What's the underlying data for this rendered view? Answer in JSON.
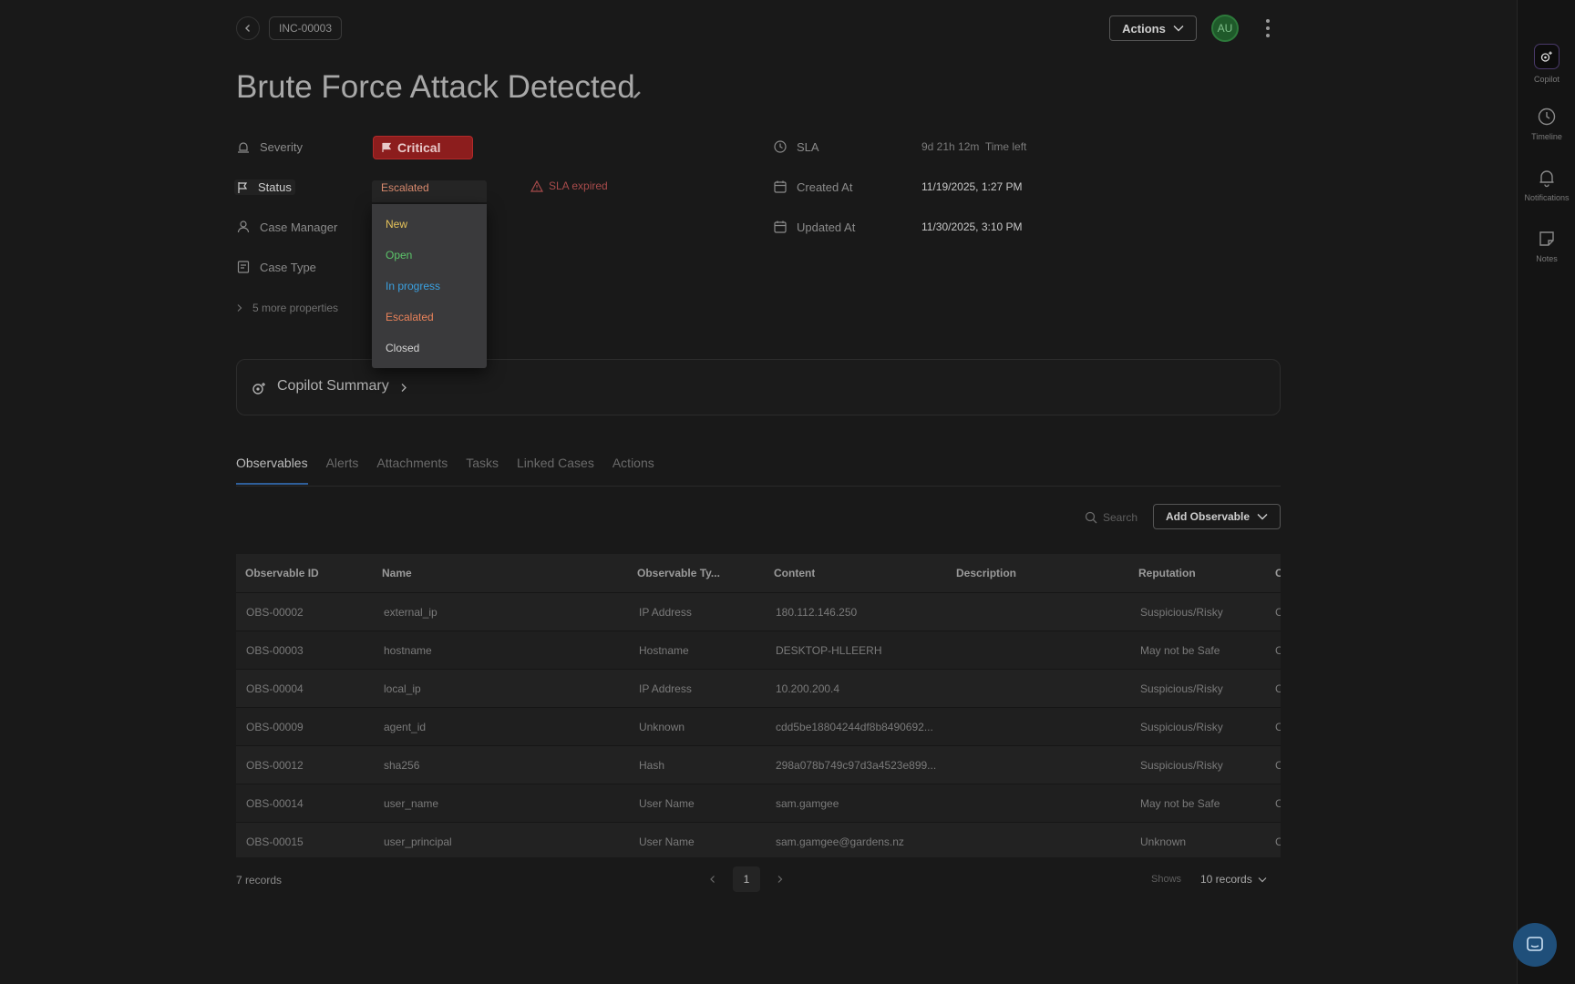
{
  "header": {
    "incident_id": "INC-00003",
    "actions_label": "Actions",
    "avatar_initials": "AU",
    "title": "Brute Force Attack Detected"
  },
  "properties": {
    "severity_label": "Severity",
    "severity_value": "Critical",
    "status_label": "Status",
    "status_value": "Escalated",
    "sla_expired": "SLA expired",
    "case_manager_label": "Case Manager",
    "case_type_label": "Case Type",
    "more_properties": "5 more properties",
    "sla_label": "SLA",
    "sla_value": "9d 21h 12m  Time left",
    "created_label": "Created At",
    "created_value": "11/19/2025, 1:27 PM",
    "updated_label": "Updated At",
    "updated_value": "11/30/2025, 3:10 PM"
  },
  "status_dropdown": {
    "options": [
      {
        "label": "New",
        "color": "#e6c35a"
      },
      {
        "label": "Open",
        "color": "#5cc46a"
      },
      {
        "label": "In progress",
        "color": "#3aa0e0"
      },
      {
        "label": "Escalated",
        "color": "#e9825a"
      },
      {
        "label": "Closed",
        "color": "#d4d4d4"
      }
    ]
  },
  "copilot_summary": {
    "label": "Copilot Summary"
  },
  "tabs": [
    "Observables",
    "Alerts",
    "Attachments",
    "Tasks",
    "Linked Cases",
    "Actions"
  ],
  "active_tab": "Observables",
  "toolbar": {
    "search_placeholder": "Search",
    "add_observable": "Add Observable"
  },
  "table": {
    "columns": [
      "Observable ID",
      "Name",
      "Observable Ty...",
      "Content",
      "Description",
      "Reputation",
      "C"
    ],
    "rows": [
      [
        "OBS-00002",
        "external_ip",
        "IP Address",
        "180.112.146.250",
        "",
        "Suspicious/Risky",
        "C"
      ],
      [
        "OBS-00003",
        "hostname",
        "Hostname",
        "DESKTOP-HLLEERH",
        "",
        "May not be Safe",
        "C"
      ],
      [
        "OBS-00004",
        "local_ip",
        "IP Address",
        "10.200.200.4",
        "",
        "Suspicious/Risky",
        "C"
      ],
      [
        "OBS-00009",
        "agent_id",
        "Unknown",
        "cdd5be18804244df8b8490692...",
        "",
        "Suspicious/Risky",
        "C"
      ],
      [
        "OBS-00012",
        "sha256",
        "Hash",
        "298a078b749c97d3a4523e899...",
        "",
        "Suspicious/Risky",
        "C"
      ],
      [
        "OBS-00014",
        "user_name",
        "User Name",
        "sam.gamgee",
        "",
        "May not be Safe",
        "C"
      ],
      [
        "OBS-00015",
        "user_principal",
        "User Name",
        "sam.gamgee@gardens.nz",
        "",
        "Unknown",
        "C"
      ]
    ]
  },
  "footer": {
    "records": "7 records",
    "page": "1",
    "shows_label": "Shows",
    "per_page": "10 records"
  },
  "rail": {
    "items": [
      "Copilot",
      "Timeline",
      "Notifications",
      "Notes"
    ]
  }
}
